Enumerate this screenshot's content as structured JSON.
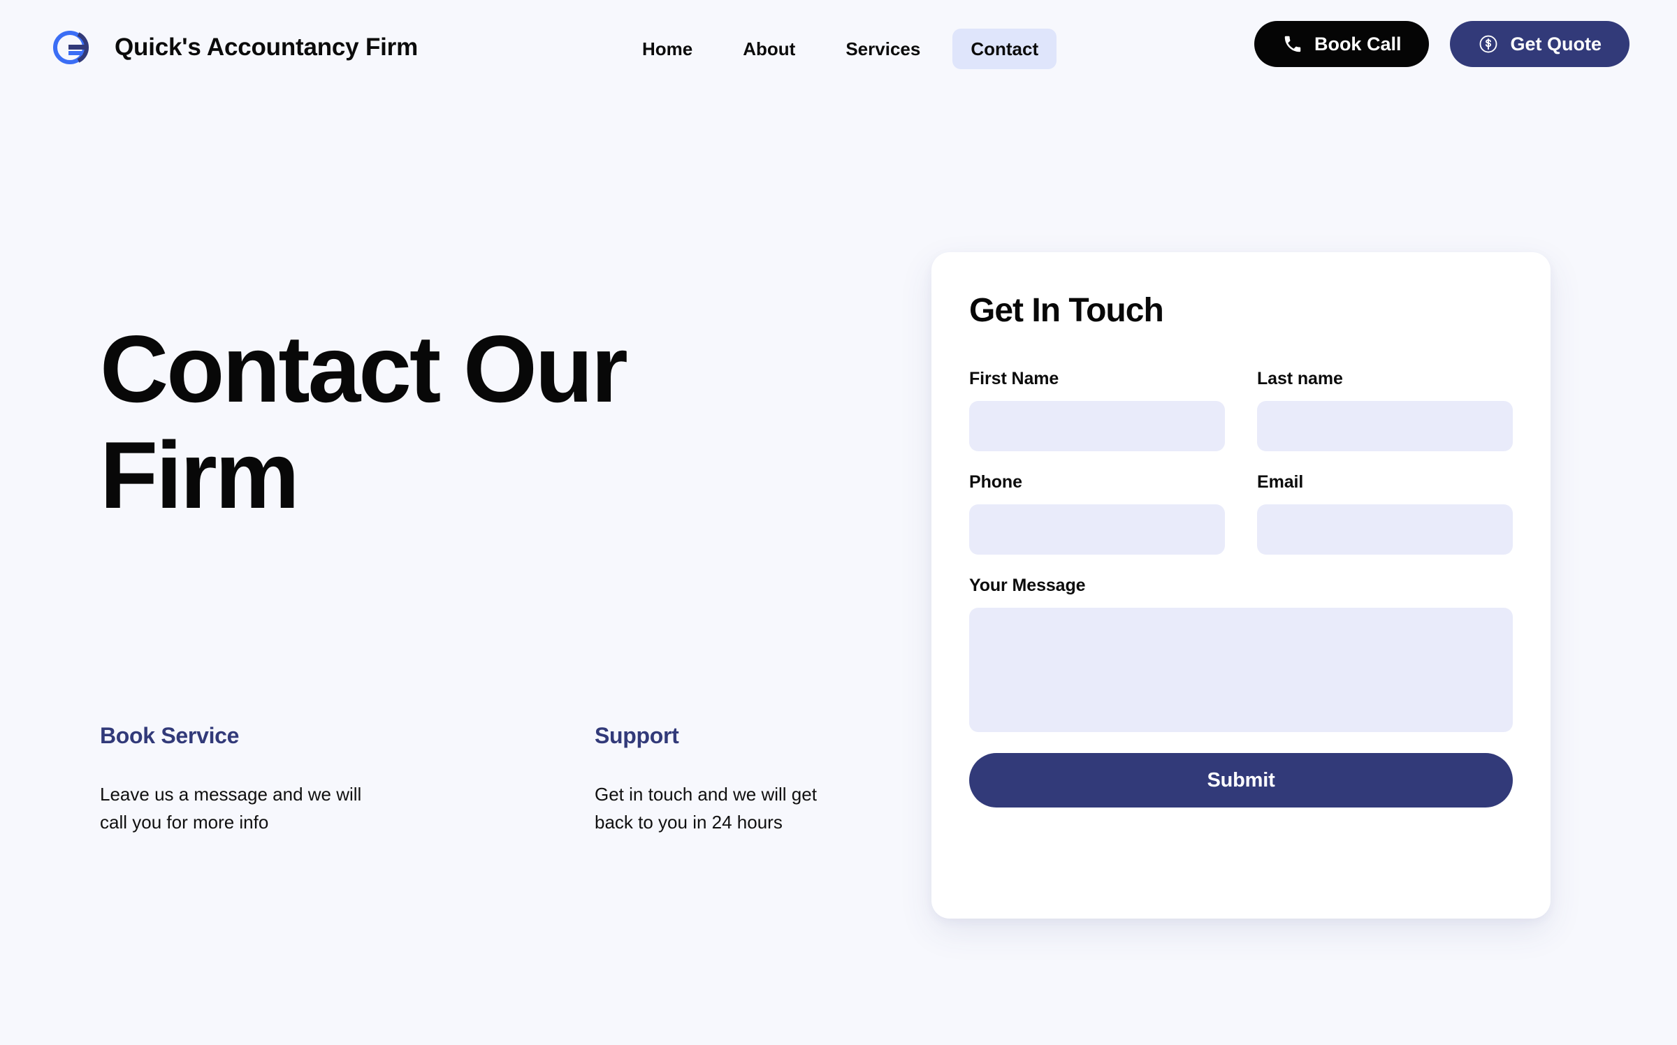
{
  "theme": {
    "page_background": "#f7f8fd",
    "brand_navy": "#323a79",
    "brand_blue": "#3b6ef5",
    "black": "#050505",
    "field_background": "#e9ebfa",
    "active_nav_background": "#dfe5fb",
    "card_background": "#ffffff"
  },
  "header": {
    "brand_name": "Quick's Accountancy Firm",
    "logo_icon": "circle-arrow-logo",
    "nav": [
      {
        "label": "Home",
        "active": false
      },
      {
        "label": "About",
        "active": false
      },
      {
        "label": "Services",
        "active": false
      },
      {
        "label": "Contact",
        "active": true
      }
    ],
    "actions": {
      "book_call": {
        "label": "Book Call",
        "icon": "phone-icon"
      },
      "get_quote": {
        "label": "Get Quote",
        "icon": "dollar-circle-icon"
      }
    }
  },
  "hero": {
    "title": "Contact Our Firm",
    "info_blocks": [
      {
        "heading": "Book Service",
        "text": "Leave us a message and we will call you for more info"
      },
      {
        "heading": "Support",
        "text": "Get in touch and we will get back to you in 24 hours"
      }
    ]
  },
  "form": {
    "title": "Get In Touch",
    "fields": {
      "first_name": {
        "label": "First Name",
        "value": "",
        "placeholder": ""
      },
      "last_name": {
        "label": "Last name",
        "value": "",
        "placeholder": ""
      },
      "phone": {
        "label": "Phone",
        "value": "",
        "placeholder": ""
      },
      "email": {
        "label": "Email",
        "value": "",
        "placeholder": ""
      },
      "message": {
        "label": "Your Message",
        "value": "",
        "placeholder": ""
      }
    },
    "submit_label": "Submit"
  }
}
